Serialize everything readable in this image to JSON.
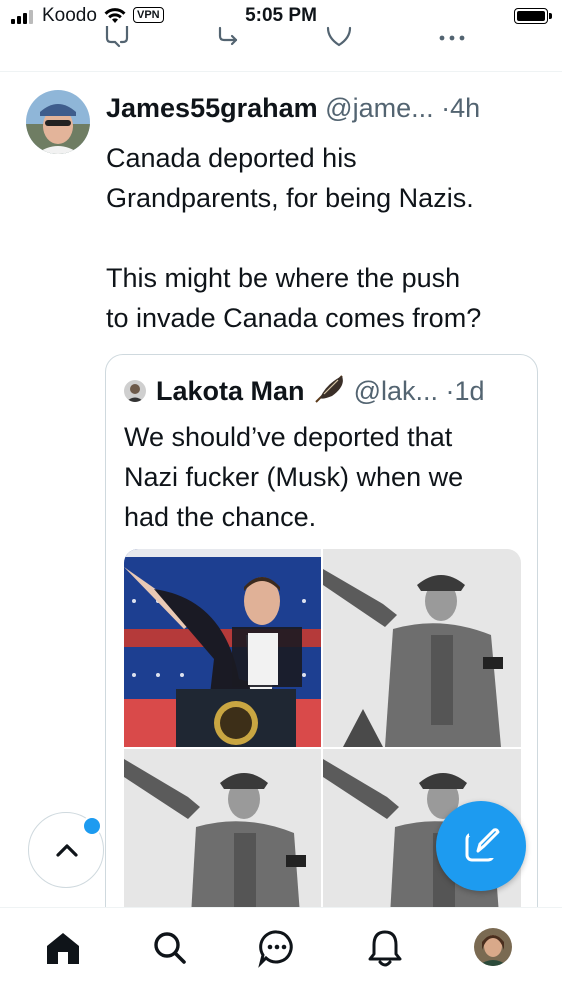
{
  "status_bar": {
    "carrier": "Koodo",
    "vpn": "VPN",
    "time": "5:05 PM"
  },
  "action_row_icons": [
    "reply-icon",
    "retweet-icon",
    "like-icon",
    "more-icon"
  ],
  "tweet": {
    "display_name": "James55graham",
    "handle": "@jame...",
    "separator": "·",
    "time": "4h",
    "text": "Canada deported his\nGrandparents, for being Nazis.\n\nThis might be where the push\nto invade Canada comes from?"
  },
  "quoted_tweet": {
    "display_name": "Lakota Man",
    "emoji": "feather-icon",
    "handle": "@lak...",
    "separator": "·",
    "time": "1d",
    "text": "We should’ve deported that\nNazi fucker (Musk) when we\nhad the chance.",
    "media_count": 4
  },
  "floating": {
    "scroll_top_icon": "chevron-up-icon",
    "compose_icon": "compose-icon"
  },
  "tab_bar": {
    "tabs": [
      "home-icon",
      "search-icon",
      "messages-icon",
      "notifications-icon",
      "profile-avatar"
    ]
  },
  "colors": {
    "accent": "#1d9bf0",
    "secondary_text": "#536471",
    "border": "#cfd9de"
  }
}
